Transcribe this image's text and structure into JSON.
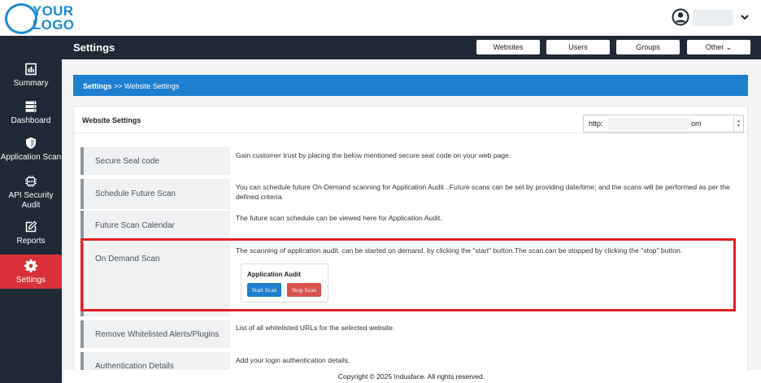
{
  "logo": {
    "line1": "YOUR",
    "line2": "LOGO"
  },
  "header": {
    "title": "Settings"
  },
  "top_nav": [
    {
      "label": "Websites"
    },
    {
      "label": "Users"
    },
    {
      "label": "Groups"
    },
    {
      "label": "Other ⌄"
    }
  ],
  "sidebar": {
    "items": [
      {
        "label": "Summary",
        "icon": "summary-icon"
      },
      {
        "label": "Dashboard",
        "icon": "dashboard-icon"
      },
      {
        "label": "Application Scan",
        "icon": "shield-icon"
      },
      {
        "label": "API Security Audit",
        "icon": "api-chip-icon"
      },
      {
        "label": "Reports",
        "icon": "edit-report-icon"
      },
      {
        "label": "Settings",
        "icon": "gear-icon",
        "active": true
      }
    ]
  },
  "breadcrumb": {
    "root": "Settings",
    "separator": ">>",
    "current": "Website Settings"
  },
  "panel": {
    "title": "Website Settings",
    "site_select": {
      "prefix": "http:",
      "suffix": "om"
    }
  },
  "rows": [
    {
      "label": "Secure Seal code",
      "desc": "Gain customer trust by placing the below mentioned secure seal code on your web page."
    },
    {
      "label": "Schedule Future Scan",
      "desc": "You can schedule future On-Demand scanning for Application Audit . Future scans can be set by providing date/time; and the scans will be performed as per the defined criteria."
    },
    {
      "label": "Future Scan Calendar",
      "desc": "The future scan schedule can be viewed here for Application Audit."
    },
    {
      "label": "On Demand Scan",
      "desc": "The scanning of application audit. can be started on demand, by clicking the \"start\" button.The scan can be stopped by clicking the \"stop\" button."
    },
    {
      "label": "Remove Whitelisted Alerts/Plugins",
      "desc": "List of all whitelisted URLs for the selected website."
    },
    {
      "label": "Authentication Details",
      "desc": "Add your login authentication details."
    }
  ],
  "audit": {
    "title": "Application Audit",
    "start_label": "Start Scan",
    "stop_label": "Stop Scan"
  },
  "footer": {
    "text": "Copyright © 2025 Indusface. All rights reserved."
  },
  "colors": {
    "brand_blue": "#1e7fd0",
    "sidebar_bg": "#1f2a36",
    "active_red": "#d9313a",
    "highlight_red": "#e11d25",
    "stop_red": "#d9534f"
  }
}
